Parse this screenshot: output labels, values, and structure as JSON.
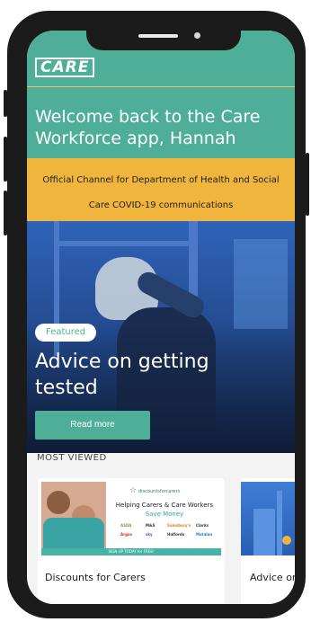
{
  "header": {
    "logo_text": "CARE",
    "welcome": "Welcome back to the Care Workforce app, Hannah"
  },
  "banner": {
    "line1": "Official Channel for Department of Health and Social",
    "line2": "Care COVID-19 communications"
  },
  "hero": {
    "badge": "Featured",
    "title": "Advice on getting tested",
    "button_label": "Read more"
  },
  "most_viewed": {
    "section_label": "MOST VIEWED",
    "cards": [
      {
        "title": "Discounts for Carers",
        "thumb": {
          "brand": "discountsforcarers",
          "headline1": "Helping Carers & Care Workers",
          "headline2": "Save Money",
          "logos": [
            "ASDA",
            "M&S",
            "Sainsbury's",
            "Clarks",
            "Argos",
            "sky",
            "Halfords",
            "Matalan"
          ],
          "strip": "SIGN UP TODAY for FREE!"
        }
      },
      {
        "title": "Advice on getting tested"
      }
    ]
  },
  "colors": {
    "brand_green": "#4fae97",
    "banner_yellow": "#f0b53c",
    "phone_frame": "#1b1b1b"
  }
}
